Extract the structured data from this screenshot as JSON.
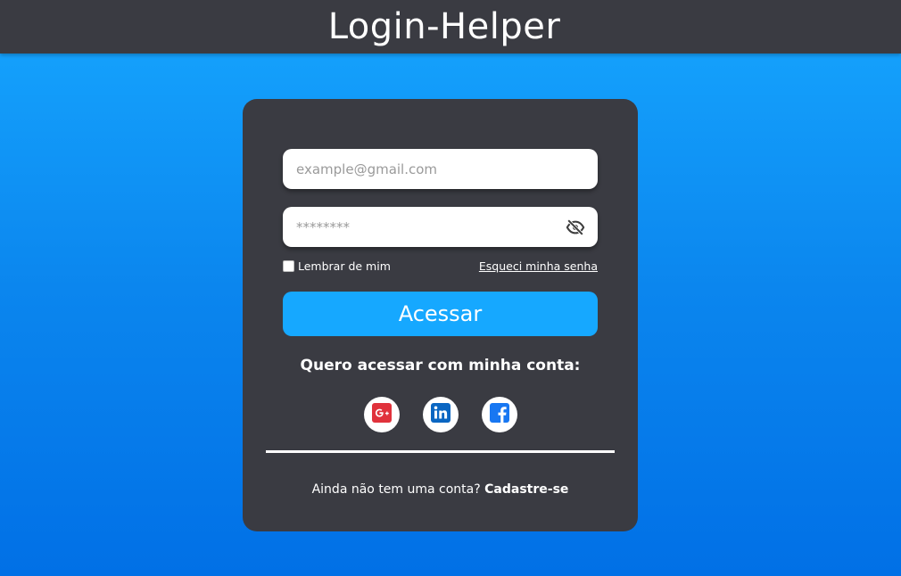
{
  "header": {
    "title": "Login-Helper"
  },
  "form": {
    "email_placeholder": "example@gmail.com",
    "password_placeholder": "********",
    "remember_label": "Lembrar de mim",
    "forgot_label": "Esqueci minha senha",
    "submit_label": "Acessar",
    "social_title": "Quero acessar com minha conta:",
    "socials": [
      {
        "name": "google-plus",
        "icon": "google-plus-icon",
        "color": "#e0323c"
      },
      {
        "name": "linkedin",
        "icon": "linkedin-icon",
        "color": "#0a66c2"
      },
      {
        "name": "facebook",
        "icon": "facebook-icon",
        "color": "#1877f2"
      }
    ],
    "signup_prompt": "Ainda não tem uma conta?",
    "signup_link": "Cadastre-se"
  },
  "colors": {
    "header_bg": "#3a3b42",
    "card_bg": "#3a3b42",
    "accent": "#16a8ff",
    "bg_top": "#16a6ff",
    "bg_bottom": "#0170e6"
  }
}
